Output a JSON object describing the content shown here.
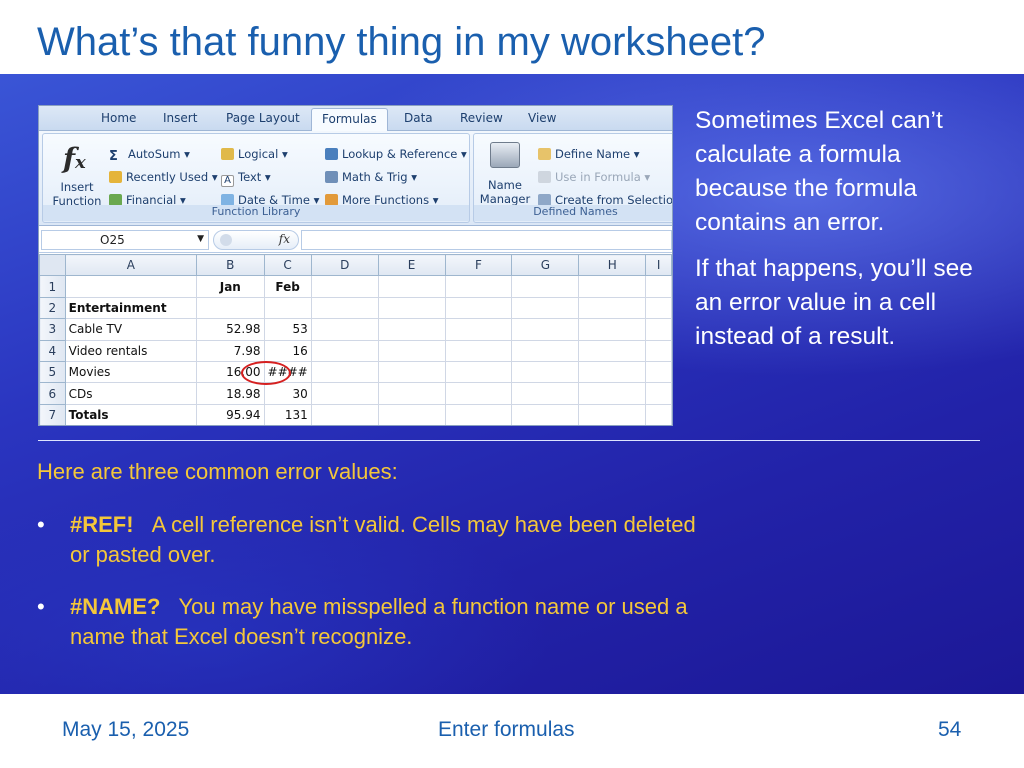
{
  "slide": {
    "title": "What’s that funny thing in my worksheet?"
  },
  "excel": {
    "tabs": [
      "Home",
      "Insert",
      "Page Layout",
      "Formulas",
      "Data",
      "Review",
      "View"
    ],
    "active_tab": "Formulas",
    "ribbon": {
      "insert_function": {
        "line1": "Insert",
        "line2": "Function"
      },
      "function_library": {
        "label": "Function Library",
        "col1": [
          "AutoSum ▾",
          "Recently Used ▾",
          "Financial ▾"
        ],
        "col2": [
          "Logical ▾",
          "Text ▾",
          "Date & Time ▾"
        ],
        "col3": [
          "Lookup & Reference ▾",
          "Math & Trig ▾",
          "More Functions ▾"
        ]
      },
      "defined_names": {
        "label": "Defined Names",
        "name_manager": {
          "line1": "Name",
          "line2": "Manager"
        },
        "items": [
          "Define Name ▾",
          "Use in Formula ▾",
          "Create from Selection"
        ]
      }
    },
    "name_box": "O25",
    "fx_symbol": "fx",
    "column_headers": [
      "A",
      "B",
      "C",
      "D",
      "E",
      "F",
      "G",
      "H",
      "I"
    ],
    "rows": [
      {
        "num": "1",
        "a": "",
        "b": "Jan",
        "c": "Feb"
      },
      {
        "num": "2",
        "a": "Entertainment",
        "b": "",
        "c": ""
      },
      {
        "num": "3",
        "a": "Cable TV",
        "b": "52.98",
        "c": "53"
      },
      {
        "num": "4",
        "a": "Video rentals",
        "b": "7.98",
        "c": "16"
      },
      {
        "num": "5",
        "a": "Movies",
        "b": "16.00",
        "c": "####"
      },
      {
        "num": "6",
        "a": "CDs",
        "b": "18.98",
        "c": "30"
      },
      {
        "num": "7",
        "a": "Totals",
        "b": "95.94",
        "c": "131"
      }
    ]
  },
  "side_text": {
    "para1": "Sometimes Excel can’t calculate a formula because the formula contains an error.",
    "para2": "If that happens, you’ll see an error value in a cell instead of a result."
  },
  "errors": {
    "intro": "Here are three common error values:",
    "items": [
      {
        "bullet": "•",
        "code": "#REF!",
        "text": "A cell reference isn’t valid. Cells may have been deleted or pasted over."
      },
      {
        "bullet": "•",
        "code": "#NAME?",
        "text": "You may have misspelled a function name or used a name that Excel doesn’t recognize."
      }
    ]
  },
  "footer": {
    "date": "May 15, 2025",
    "center": "Enter formulas",
    "page": "54"
  },
  "colors": {
    "title": "#1a5fae",
    "bg_blue": "#2a35c0",
    "body_text": "#ffffff",
    "highlight_text": "#f4c73a",
    "error_circle": "#d62020"
  }
}
